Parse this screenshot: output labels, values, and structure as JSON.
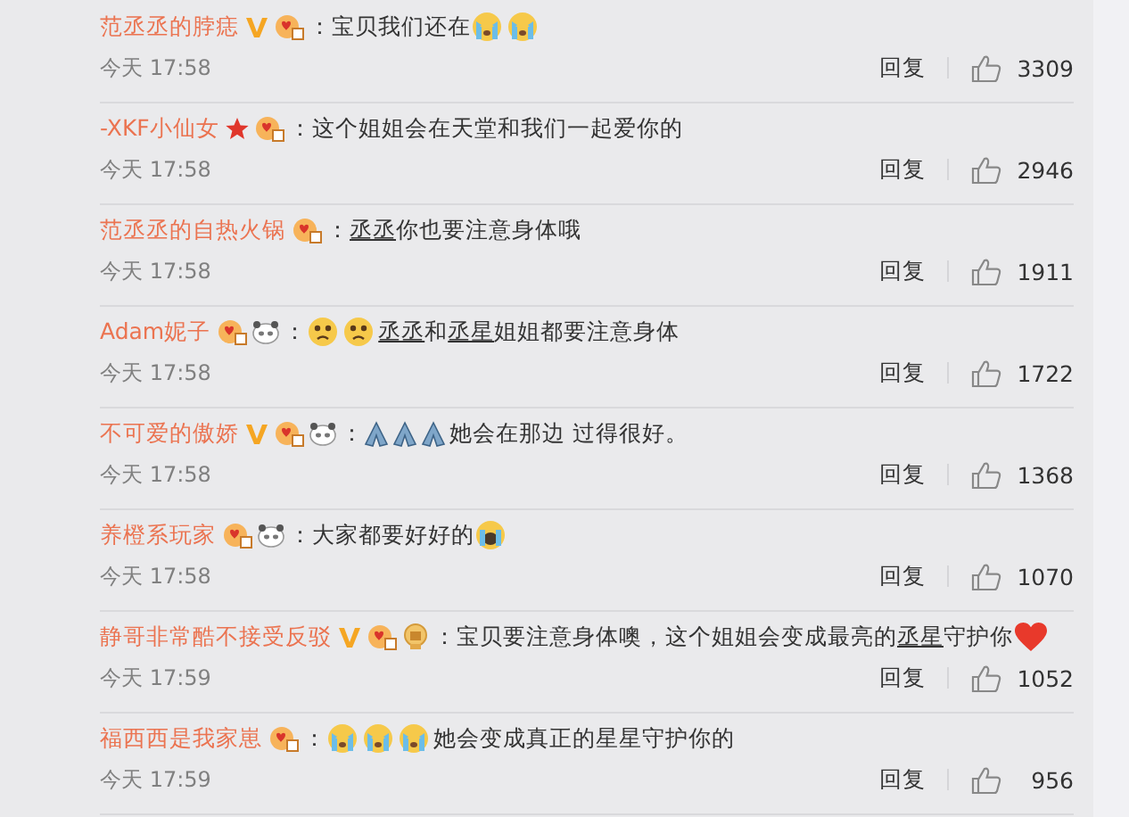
{
  "comments": [
    {
      "name": "范丞丞的脖痣",
      "badges": [
        {
          "kind": "verified"
        },
        {
          "kind": "fan"
        }
      ],
      "parts": [
        {
          "kind": "text",
          "text": "：宝贝我们还在"
        },
        {
          "kind": "cry"
        },
        {
          "kind": "cry"
        }
      ],
      "time": "今天 17:58",
      "reply": "回复",
      "likes": "3309"
    },
    {
      "name": "-XKF小仙女",
      "badges": [
        {
          "kind": "star"
        },
        {
          "kind": "fan"
        }
      ],
      "parts": [
        {
          "kind": "text",
          "text": "：这个姐姐会在天堂和我们一起爱你的"
        }
      ],
      "time": "今天 17:58",
      "reply": "回复",
      "likes": "2946"
    },
    {
      "name": "范丞丞的自热火锅",
      "badges": [
        {
          "kind": "fan"
        }
      ],
      "parts": [
        {
          "kind": "text",
          "text": "："
        },
        {
          "kind": "mention",
          "text": "丞丞"
        },
        {
          "kind": "text",
          "text": " 你也要注意身体哦"
        }
      ],
      "time": "今天 17:58",
      "reply": "回复",
      "likes": "1911"
    },
    {
      "name": "Adam妮子",
      "badges": [
        {
          "kind": "fan"
        },
        {
          "kind": "panda"
        }
      ],
      "parts": [
        {
          "kind": "text",
          "text": "："
        },
        {
          "kind": "worried"
        },
        {
          "kind": "worried"
        },
        {
          "kind": "mention",
          "text": "丞丞"
        },
        {
          "kind": "text",
          "text": "和"
        },
        {
          "kind": "mention",
          "text": "丞星"
        },
        {
          "kind": "text",
          "text": "姐姐都要注意身体"
        }
      ],
      "time": "今天 17:58",
      "reply": "回复",
      "likes": "1722"
    },
    {
      "name": "不可爱的傲娇",
      "badges": [
        {
          "kind": "verified"
        },
        {
          "kind": "fan"
        },
        {
          "kind": "panda"
        }
      ],
      "parts": [
        {
          "kind": "text",
          "text": "："
        },
        {
          "kind": "pray"
        },
        {
          "kind": "pray"
        },
        {
          "kind": "pray"
        },
        {
          "kind": "text",
          "text": "她会在那边 过得很好。"
        }
      ],
      "time": "今天 17:58",
      "reply": "回复",
      "likes": "1368"
    },
    {
      "name": "养橙系玩家",
      "badges": [
        {
          "kind": "fan"
        },
        {
          "kind": "panda"
        }
      ],
      "parts": [
        {
          "kind": "text",
          "text": "：大家都要好好的"
        },
        {
          "kind": "sob"
        }
      ],
      "time": "今天 17:58",
      "reply": "回复",
      "likes": "1070"
    },
    {
      "name": "静哥非常酷不接受反驳",
      "badges": [
        {
          "kind": "verified"
        },
        {
          "kind": "fan"
        },
        {
          "kind": "medal"
        }
      ],
      "parts": [
        {
          "kind": "text",
          "text": "：宝贝要注意身体噢，这个姐姐会变成最亮的"
        },
        {
          "kind": "mention",
          "text": "丞星"
        },
        {
          "kind": "text",
          "text": "守护你"
        },
        {
          "kind": "heart"
        }
      ],
      "time": "今天 17:59",
      "reply": "回复",
      "likes": "1052"
    },
    {
      "name": "福西西是我家崽",
      "badges": [
        {
          "kind": "fan"
        }
      ],
      "parts": [
        {
          "kind": "text",
          "text": "："
        },
        {
          "kind": "cry"
        },
        {
          "kind": "cry"
        },
        {
          "kind": "cry"
        },
        {
          "kind": "text",
          "text": "她会变成真正的星星守护你的"
        }
      ],
      "time": "今天 17:59",
      "reply": "回复",
      "likes": "956"
    }
  ]
}
